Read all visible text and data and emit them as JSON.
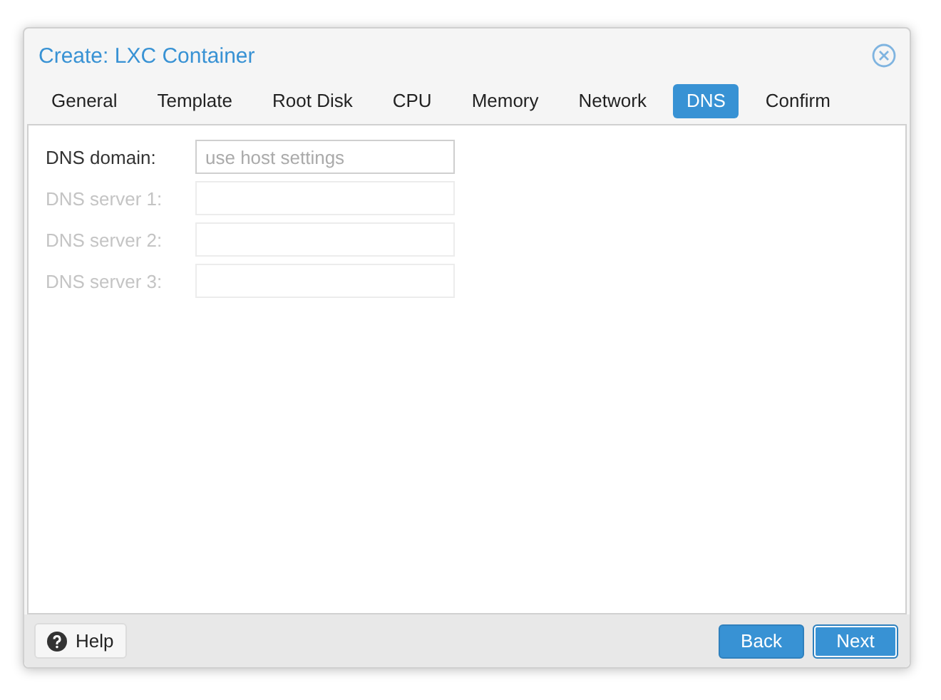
{
  "window": {
    "title": "Create: LXC Container"
  },
  "tabs": [
    {
      "label": "General",
      "selected": false
    },
    {
      "label": "Template",
      "selected": false
    },
    {
      "label": "Root Disk",
      "selected": false
    },
    {
      "label": "CPU",
      "selected": false
    },
    {
      "label": "Memory",
      "selected": false
    },
    {
      "label": "Network",
      "selected": false
    },
    {
      "label": "DNS",
      "selected": true
    },
    {
      "label": "Confirm",
      "selected": false
    }
  ],
  "fields": [
    {
      "label": "DNS domain:",
      "placeholder": "use host settings",
      "disabled": false
    },
    {
      "label": "DNS server 1:",
      "disabled": true
    },
    {
      "label": "DNS server 2:",
      "disabled": true
    },
    {
      "label": "DNS server 3:",
      "disabled": true
    }
  ],
  "footer": {
    "help": "Help",
    "buttons": [
      "Back",
      "Next"
    ]
  }
}
